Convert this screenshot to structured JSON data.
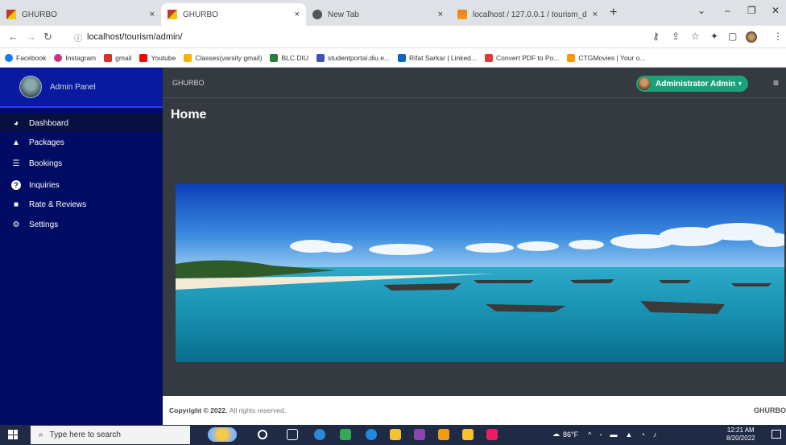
{
  "browser": {
    "tabs": [
      {
        "label": "GHURBO",
        "close": "×"
      },
      {
        "label": "GHURBO",
        "close": "×"
      },
      {
        "label": "New Tab",
        "close": "×"
      },
      {
        "label": "localhost / 127.0.0.1 / tourism_d",
        "close": "×"
      }
    ],
    "new_tab": "+",
    "controls": {
      "dropdown": "⌄",
      "minimize": "–",
      "maximize": "❐",
      "close": "✕"
    },
    "url": "localhost/tourism/admin/",
    "bookmarks": [
      {
        "label": "Facebook",
        "color": "#1877f2"
      },
      {
        "label": "Instagram",
        "color": "#c13584"
      },
      {
        "label": "gmail",
        "color": "#d93025"
      },
      {
        "label": "Youtube",
        "color": "#ff0000"
      },
      {
        "label": "Classes(varsity gmail)",
        "color": "#f4b400"
      },
      {
        "label": "BLC.DIU",
        "color": "#2e7d32"
      },
      {
        "label": "studentportal.diu.e...",
        "color": "#3f51b5"
      },
      {
        "label": "Rifat Sarkar | Linked...",
        "color": "#0a66c2"
      },
      {
        "label": "Convert PDF to Po...",
        "color": "#e53935"
      },
      {
        "label": "CTGMovies | Your o...",
        "color": "#ff9800"
      }
    ]
  },
  "sidebar": {
    "brand": "Admin Panel",
    "items": [
      {
        "label": "Dashboard",
        "icon": "dashboard-icon",
        "glyph": "◕"
      },
      {
        "label": "Packages",
        "icon": "packages-icon",
        "glyph": "▲"
      },
      {
        "label": "Bookings",
        "icon": "bookings-icon",
        "glyph": "☰"
      },
      {
        "label": "Inquiries",
        "icon": "question-icon",
        "glyph": "?"
      },
      {
        "label": "Rate & Reviews",
        "icon": "comment-icon",
        "glyph": "■"
      },
      {
        "label": "Settings",
        "icon": "gears-icon",
        "glyph": "⚙"
      }
    ]
  },
  "header": {
    "app_name": "GHURBO",
    "admin_label": "Administrator Admin",
    "hamburger": "≡"
  },
  "page": {
    "title": "Home"
  },
  "footer": {
    "copyright": "Copyright © 2022.",
    "rights": "All rights reserved.",
    "brand": "GHURBO"
  },
  "taskbar": {
    "search_placeholder": "Type here to search",
    "weather": "86°F",
    "time": "12:21 AM",
    "date": "8/20/2022"
  }
}
